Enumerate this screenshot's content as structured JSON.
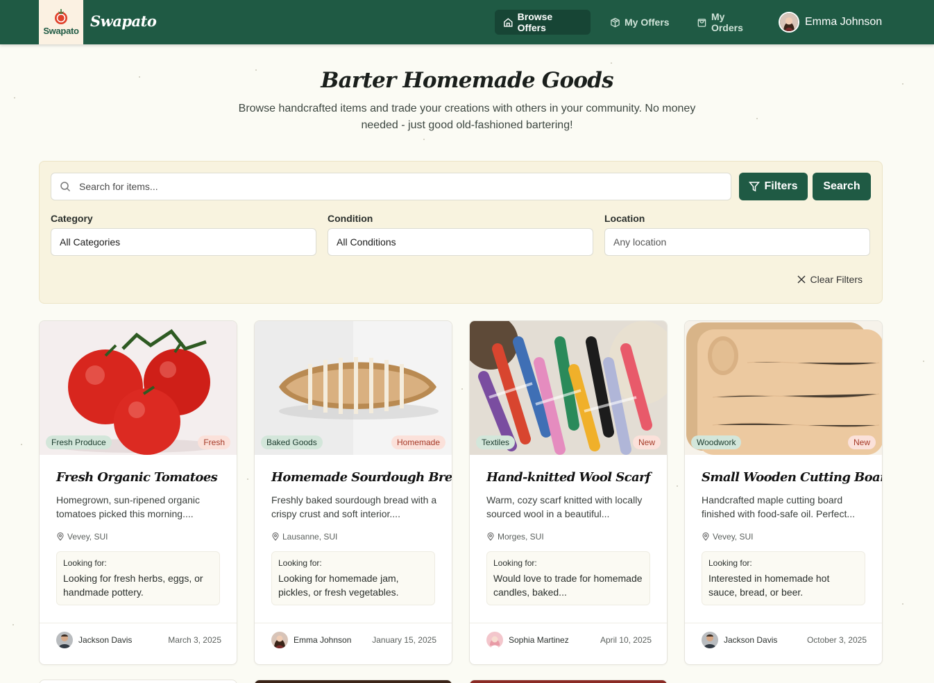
{
  "header": {
    "logo_text": "Swapato",
    "brand": "Swapato",
    "nav": [
      {
        "label": "Browse Offers",
        "icon": "home-icon"
      },
      {
        "label": "My Offers",
        "icon": "box-icon"
      },
      {
        "label": "My Orders",
        "icon": "bag-icon"
      }
    ],
    "user_name": "Emma Johnson"
  },
  "hero": {
    "title": "Barter Homemade Goods",
    "subtitle": "Browse handcrafted items and trade your creations with others in your community. No money needed - just good old-fashioned bartering!"
  },
  "filters": {
    "search_placeholder": "Search for items...",
    "filters_label": "Filters",
    "search_label": "Search",
    "category_label": "Category",
    "category_value": "All Categories",
    "condition_label": "Condition",
    "condition_value": "All Conditions",
    "location_label": "Location",
    "location_placeholder": "Any location",
    "clear_label": "Clear Filters"
  },
  "cards": [
    {
      "category": "Fresh Produce",
      "condition": "Fresh",
      "title": "Fresh Organic Tomatoes",
      "description": "Homegrown, sun-ripened organic tomatoes picked this morning....",
      "location": "Vevey, SUI",
      "looking_label": "Looking for:",
      "looking_for": "Looking for fresh herbs, eggs, or handmade pottery.",
      "user": "Jackson Davis",
      "date": "March 3, 2025"
    },
    {
      "category": "Baked Goods",
      "condition": "Homemade",
      "title": "Homemade Sourdough Bread",
      "description": "Freshly baked sourdough bread with a crispy crust and soft interior....",
      "location": "Lausanne, SUI",
      "looking_label": "Looking for:",
      "looking_for": "Looking for homemade jam, pickles, or fresh vegetables.",
      "user": "Emma Johnson",
      "date": "January 15, 2025"
    },
    {
      "category": "Textiles",
      "condition": "New",
      "title": "Hand-knitted Wool Scarf",
      "description": "Warm, cozy scarf knitted with locally sourced wool in a beautiful...",
      "location": "Morges, SUI",
      "looking_label": "Looking for:",
      "looking_for": "Would love to trade for homemade candles, baked...",
      "user": "Sophia Martinez",
      "date": "April 10, 2025"
    },
    {
      "category": "Woodwork",
      "condition": "New",
      "title": "Small Wooden Cutting Board",
      "description": "Handcrafted maple cutting board finished with food-safe oil. Perfect...",
      "location": "Vevey, SUI",
      "looking_label": "Looking for:",
      "looking_for": "Interested in homemade hot sauce, bread, or beer.",
      "user": "Jackson Davis",
      "date": "October 3, 2025"
    }
  ]
}
